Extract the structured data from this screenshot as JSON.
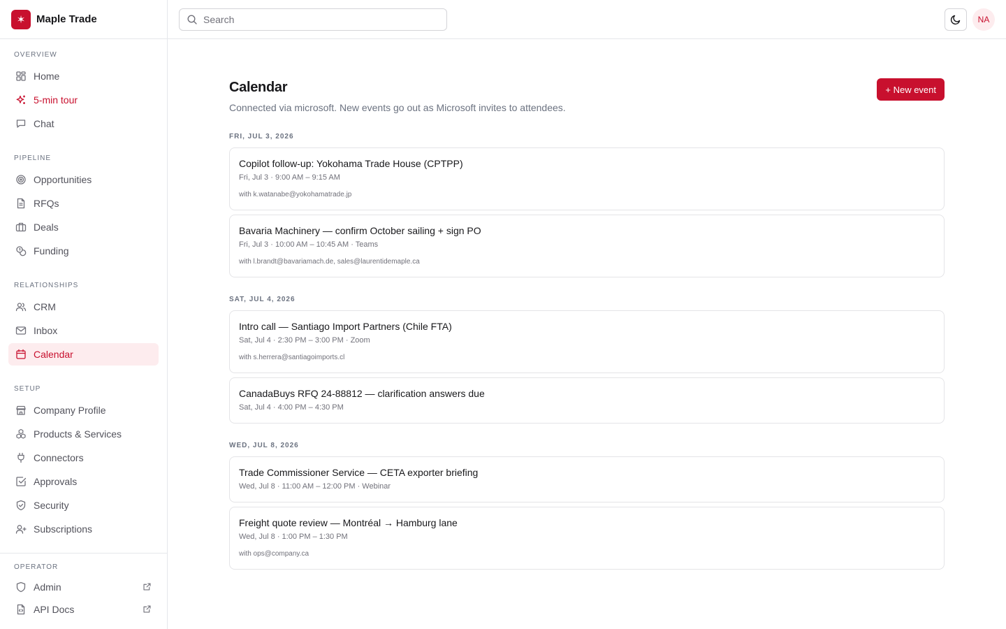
{
  "brand": {
    "name": "Maple Trade",
    "logo_glyph": "✶",
    "color": "#c8102e"
  },
  "sidebar": {
    "sections": [
      {
        "label": "Overview",
        "items": [
          {
            "label": "Home",
            "icon": "grid-icon"
          },
          {
            "label": "5-min tour",
            "icon": "sparkles-icon",
            "highlight": true
          },
          {
            "label": "Chat",
            "icon": "chat-icon"
          }
        ]
      },
      {
        "label": "Pipeline",
        "items": [
          {
            "label": "Opportunities",
            "icon": "target-icon"
          },
          {
            "label": "RFQs",
            "icon": "document-icon"
          },
          {
            "label": "Deals",
            "icon": "briefcase-icon"
          },
          {
            "label": "Funding",
            "icon": "coins-icon"
          }
        ]
      },
      {
        "label": "Relationships",
        "items": [
          {
            "label": "CRM",
            "icon": "users-icon"
          },
          {
            "label": "Inbox",
            "icon": "mail-icon"
          },
          {
            "label": "Calendar",
            "icon": "calendar-icon",
            "active": true
          }
        ]
      },
      {
        "label": "Setup",
        "items": [
          {
            "label": "Company Profile",
            "icon": "store-icon"
          },
          {
            "label": "Products & Services",
            "icon": "boxes-icon"
          },
          {
            "label": "Connectors",
            "icon": "plug-icon"
          },
          {
            "label": "Approvals",
            "icon": "check-square-icon"
          },
          {
            "label": "Security",
            "icon": "shield-check-icon"
          },
          {
            "label": "Subscriptions",
            "icon": "user-plus-icon"
          }
        ]
      }
    ],
    "operator": {
      "label": "Operator",
      "items": [
        {
          "label": "Admin",
          "icon": "shield-icon",
          "external": true
        },
        {
          "label": "API Docs",
          "icon": "file-code-icon",
          "external": true
        }
      ]
    }
  },
  "header": {
    "search_placeholder": "Search",
    "theme_icon": "moon-icon",
    "avatar_initials": "NA"
  },
  "main": {
    "title": "Calendar",
    "subtitle": "Connected via microsoft. New events go out as Microsoft invites to attendees.",
    "new_event_label": "+ New event",
    "days": [
      {
        "label": "FRI, JUL 3, 2026",
        "events": [
          {
            "title": "Copilot follow-up: Yokohama Trade House (CPTPP)",
            "time": "Fri, Jul 3 · 9:00 AM – 9:15 AM",
            "with": "with k.watanabe@yokohamatrade.jp"
          },
          {
            "title": "Bavaria Machinery — confirm October sailing + sign PO",
            "time": "Fri, Jul 3 · 10:00 AM – 10:45 AM · Teams",
            "with": "with l.brandt@bavariamach.de, sales@laurentidemaple.ca"
          }
        ]
      },
      {
        "label": "SAT, JUL 4, 2026",
        "events": [
          {
            "title": "Intro call — Santiago Import Partners (Chile FTA)",
            "time": "Sat, Jul 4 · 2:30 PM – 3:00 PM · Zoom",
            "with": "with s.herrera@santiagoimports.cl"
          },
          {
            "title": "CanadaBuys RFQ 24-88812 — clarification answers due",
            "time": "Sat, Jul 4 · 4:00 PM – 4:30 PM",
            "with": ""
          }
        ]
      },
      {
        "label": "WED, JUL 8, 2026",
        "events": [
          {
            "title": "Trade Commissioner Service — CETA exporter briefing",
            "time": "Wed, Jul 8 · 11:00 AM – 12:00 PM · Webinar",
            "with": ""
          },
          {
            "title": "Freight quote review — Montréal → Hamburg lane",
            "time": "Wed, Jul 8 · 1:00 PM – 1:30 PM",
            "with": "with ops@company.ca"
          }
        ]
      }
    ]
  }
}
